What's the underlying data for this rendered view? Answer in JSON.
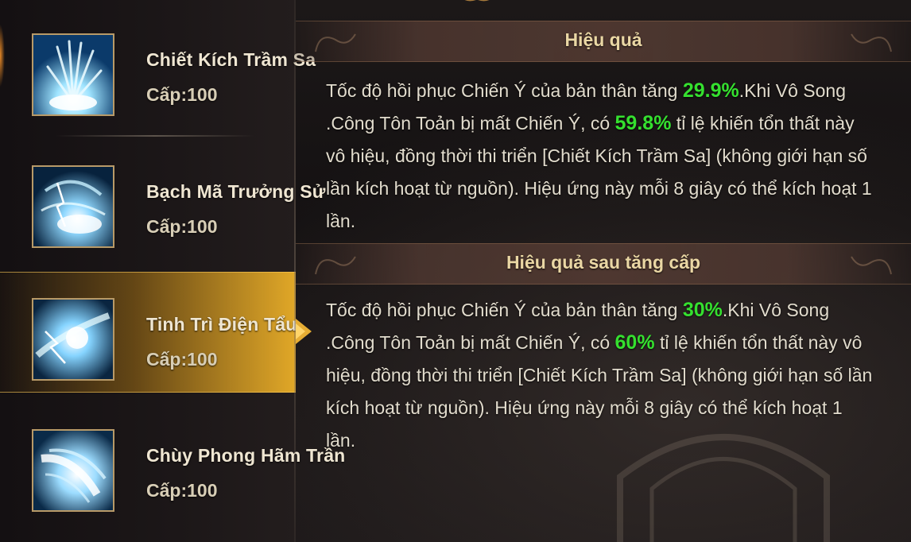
{
  "skills": [
    {
      "name": "Chiết Kích Trầm Sa",
      "level": "Cấp:100",
      "selected": false,
      "icon": "burst-skill-icon"
    },
    {
      "name": "Bạch Mã Trưởng Sử",
      "level": "Cấp:100",
      "selected": false,
      "icon": "storm-skill-icon"
    },
    {
      "name": "Tinh Trì Điện Tẩu",
      "level": "Cấp:100",
      "selected": true,
      "icon": "lightning-skill-icon"
    },
    {
      "name": "Chùy Phong Hãm Trần",
      "level": "Cấp:100",
      "selected": false,
      "icon": "wind-skill-icon"
    }
  ],
  "effect": {
    "title": "Hiệu quả",
    "parts": [
      "Tốc độ hồi phục Chiến Ý của bản thân tăng ",
      "29.9%",
      ".Khi Vô Song .Công Tôn Toản bị mất Chiến Ý, có ",
      "59.8%",
      " tỉ lệ khiến tổn thất này vô hiệu, đồng thời thi triển [Chiết Kích Trầm Sa] (không giới hạn số lần kích hoạt từ nguồn). Hiệu ứng này mỗi 8 giây có thể kích hoạt 1 lần."
    ]
  },
  "upgraded_effect": {
    "title": "Hiệu quả sau tăng cấp",
    "parts": [
      "Tốc độ hồi phục Chiến Ý của bản thân tăng ",
      "30%",
      ".Khi Vô Song .Công Tôn Toản bị mất Chiến Ý, có ",
      "60%",
      " tỉ lệ khiến tổn thất này vô hiệu, đồng thời thi triển [Chiết Kích Trầm Sa] (không giới hạn số lần kích hoạt từ nguồn). Hiệu ứng này mỗi 8 giây có thể kích hoạt 1 lần."
    ]
  },
  "colors": {
    "highlight": "#35e02f",
    "selected_gold": "#e6ad34",
    "title_gold": "#ead7a4"
  }
}
